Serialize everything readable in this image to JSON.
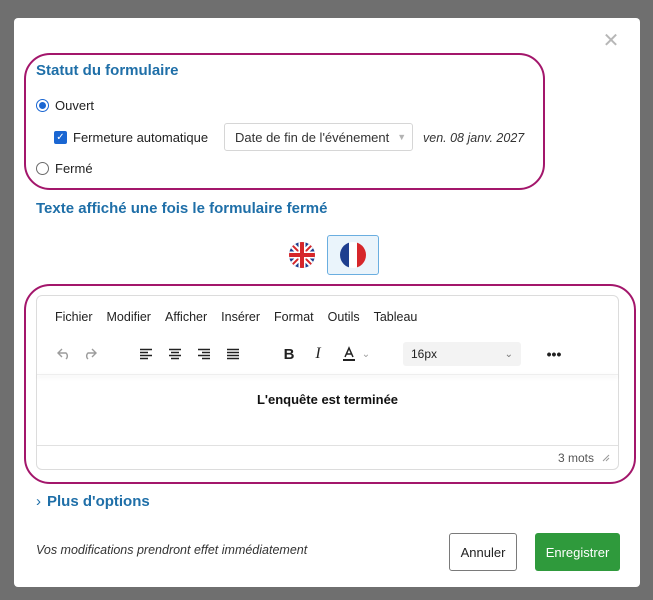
{
  "modal": {
    "close_icon": "close-icon",
    "status_section": {
      "title": "Statut du formulaire",
      "open_label": "Ouvert",
      "auto_close_label": "Fermeture automatique",
      "auto_close_checked": true,
      "auto_close_select": "Date de fin de l'événement",
      "auto_close_date": "ven. 08 janv. 2027",
      "closed_label": "Fermé",
      "selected": "Ouvert"
    },
    "closed_text_section": {
      "title": "Texte affiché une fois le formulaire fermé",
      "languages": [
        "en",
        "fr"
      ],
      "active_language": "fr"
    },
    "editor": {
      "menu": [
        "Fichier",
        "Modifier",
        "Afficher",
        "Insérer",
        "Format",
        "Outils",
        "Tableau"
      ],
      "font_size": "16px",
      "content": "L'enquête est terminée",
      "word_count": "3 mots"
    },
    "more_options": "Plus d'options",
    "footer": {
      "note": "Vos modifications prendront effet immédiatement",
      "cancel_label": "Annuler",
      "save_label": "Enregistrer"
    },
    "colors": {
      "accent_title": "#1f6fa8",
      "highlight_border": "#a3166b",
      "save_button": "#2f9a3c",
      "checkbox": "#1a66d2"
    }
  }
}
